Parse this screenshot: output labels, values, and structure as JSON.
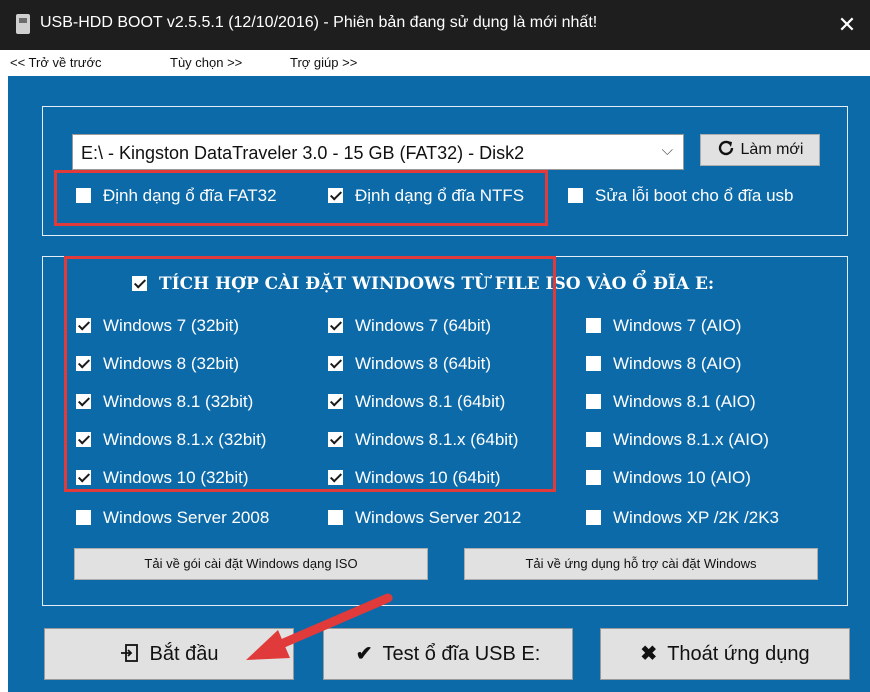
{
  "window": {
    "title": "USB-HDD BOOT v2.5.5.1 (12/10/2016) - Phiên bản đang sử dụng là mới nhất!",
    "close_icon": "close-icon"
  },
  "menu": {
    "back": "<< Trở về trước",
    "options": "Tùy chọn >>",
    "help": "Trợ giúp >>"
  },
  "drive": {
    "selected": "E:\\ - Kingston DataTraveler 3.0 - 15 GB (FAT32) - Disk2",
    "refresh_label": "Làm mới",
    "refresh_icon": "refresh-icon"
  },
  "format_options": [
    {
      "label": "Định dạng ổ đĩa FAT32",
      "checked": false
    },
    {
      "label": "Định dạng ổ đĩa NTFS",
      "checked": true
    },
    {
      "label": "Sửa lỗi boot cho ổ đĩa usb",
      "checked": false
    }
  ],
  "integrate": {
    "label": "TÍCH HỢP CÀI ĐẶT WINDOWS TỪ FILE ISO VÀO Ổ ĐĨA E:",
    "checked": true
  },
  "windows_options": [
    {
      "label": "Windows 7 (32bit)",
      "checked": true
    },
    {
      "label": "Windows 7 (64bit)",
      "checked": true
    },
    {
      "label": "Windows 7 (AIO)",
      "checked": false
    },
    {
      "label": "Windows 8 (32bit)",
      "checked": true
    },
    {
      "label": "Windows 8 (64bit)",
      "checked": true
    },
    {
      "label": "Windows 8 (AIO)",
      "checked": false
    },
    {
      "label": "Windows 8.1 (32bit)",
      "checked": true
    },
    {
      "label": "Windows 8.1 (64bit)",
      "checked": true
    },
    {
      "label": "Windows 8.1 (AIO)",
      "checked": false
    },
    {
      "label": "Windows 8.1.x (32bit)",
      "checked": true
    },
    {
      "label": "Windows 8.1.x (64bit)",
      "checked": true
    },
    {
      "label": "Windows 8.1.x (AIO)",
      "checked": false
    },
    {
      "label": "Windows 10 (32bit)",
      "checked": true
    },
    {
      "label": "Windows 10 (64bit)",
      "checked": true
    },
    {
      "label": "Windows 10 (AIO)",
      "checked": false
    },
    {
      "label": "Windows Server 2008",
      "checked": false
    },
    {
      "label": "Windows Server 2012",
      "checked": false
    },
    {
      "label": "Windows XP /2K /2K3",
      "checked": false
    }
  ],
  "downloads": {
    "iso": "Tải về gói cài đặt Windows dạng ISO",
    "tool": "Tải về ứng dụng hỗ trợ cài đặt Windows"
  },
  "actions": {
    "start": "Bắt đầu",
    "test": "Test ổ đĩa USB E:",
    "exit": "Thoát ứng dụng"
  },
  "colors": {
    "panel": "#0d6aa8",
    "highlight": "#e03a3a",
    "titlebar": "#1e1e1e"
  }
}
